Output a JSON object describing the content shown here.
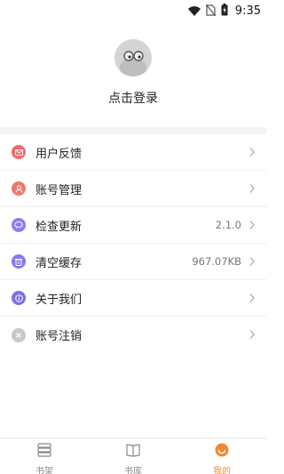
{
  "status_bar": {
    "time": "9:35"
  },
  "profile": {
    "login_label": "点击登录"
  },
  "menu": {
    "items": [
      {
        "label": "用户反馈",
        "value": "",
        "icon": "mail-icon",
        "color": "#f26a6a"
      },
      {
        "label": "账号管理",
        "value": "",
        "icon": "user-icon",
        "color": "#f0776b"
      },
      {
        "label": "检查更新",
        "value": "2.1.0",
        "icon": "chat-icon",
        "color": "#8b7cf0"
      },
      {
        "label": "清空缓存",
        "value": "967.07KB",
        "icon": "trash-icon",
        "color": "#8578ef"
      },
      {
        "label": "关于我们",
        "value": "",
        "icon": "info-icon",
        "color": "#7d6fe6"
      },
      {
        "label": "账号注销",
        "value": "",
        "icon": "close-icon",
        "color": "#c8c8c8"
      }
    ]
  },
  "bottom_nav": {
    "items": [
      {
        "label": "书架",
        "icon": "bookshelf-icon"
      },
      {
        "label": "书库",
        "icon": "book-icon"
      },
      {
        "label": "我的",
        "icon": "profile-icon"
      }
    ],
    "active_color": "#f08a2c",
    "inactive_color": "#8a8a8a"
  }
}
